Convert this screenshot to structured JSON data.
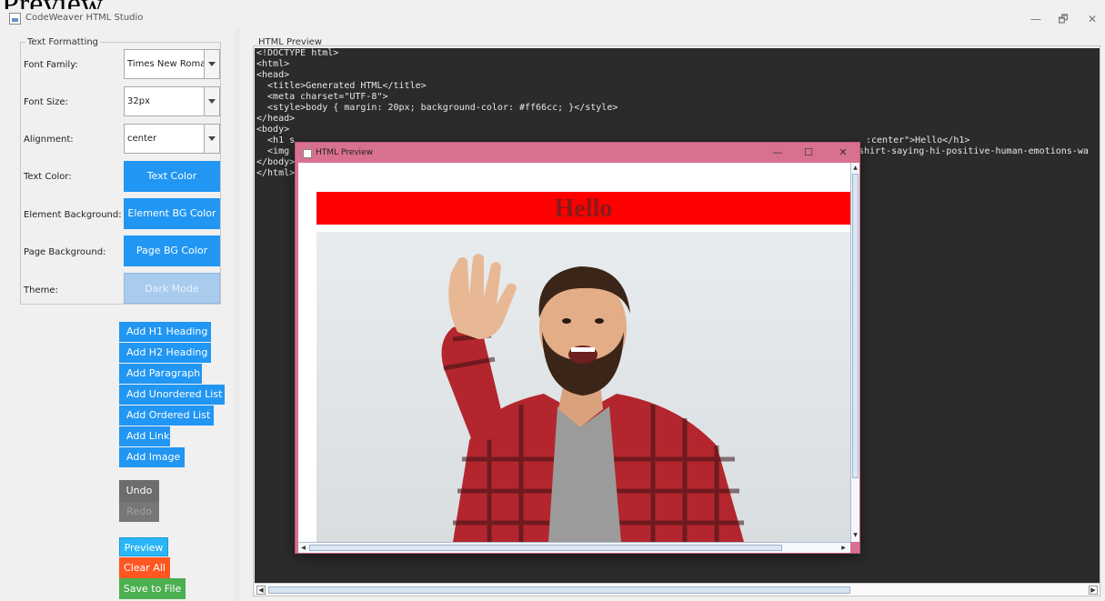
{
  "stray_heading": "Preview",
  "window": {
    "title": "CodeWeaver HTML Studio",
    "controls": {
      "minimize": "—",
      "maximize": "🗗",
      "close": "✕"
    }
  },
  "text_formatting": {
    "group_label": "Text Formatting",
    "font_family": {
      "label": "Font Family:",
      "value": "Times New Roman"
    },
    "font_size": {
      "label": "Font Size:",
      "value": "32px"
    },
    "alignment": {
      "label": "Alignment:",
      "value": "center"
    },
    "text_color": {
      "label": "Text Color:",
      "button": "Text Color"
    },
    "element_bg": {
      "label": "Element Background:",
      "button": "Element BG Color"
    },
    "page_bg": {
      "label": "Page Background:",
      "button": "Page BG Color"
    },
    "theme": {
      "label": "Theme:",
      "button": "Dark Mode"
    }
  },
  "element_buttons": {
    "h1": "Add H1 Heading",
    "h2": "Add H2 Heading",
    "paragraph": "Add Paragraph",
    "ul": "Add Unordered List",
    "ol": "Add Ordered List",
    "link": "Add Link",
    "image": "Add Image"
  },
  "history": {
    "undo": "Undo",
    "redo": "Redo"
  },
  "actions": {
    "preview": "Preview",
    "clear": "Clear All",
    "save": "Save to File"
  },
  "code_panel": {
    "label": "HTML Preview",
    "lines": [
      "<!DOCTYPE html>",
      "<html>",
      "<head>",
      "  <title>Generated HTML</title>",
      "  <meta charset=\"UTF-8\">",
      "  <style>body { margin: 20px; background-color: #ff66cc; }</style>",
      "</head>",
      "<body>",
      "  <h1 s",
      "  <img ",
      "</body>",
      "</html>"
    ],
    "hidden_tail_1": ":center\">Hello</h1>",
    "hidden_tail_2": "shirt-saying-hi-positive-human-emotions-wa"
  },
  "preview_window": {
    "title": "HTML Preview",
    "heading": "Hello",
    "image_alt": "Smiling bearded man in red plaid shirt waving hello",
    "controls": {
      "minimize": "—",
      "maximize": "☐",
      "close": "✕"
    }
  },
  "colors": {
    "primary_button": "#2196f3",
    "code_bg": "#2b2b2b",
    "popup_frame": "#d8708f",
    "heading_bg": "#ff0000",
    "heading_text": "#8b1a1a",
    "clear_button": "#ff5722",
    "save_button": "#4caf50",
    "preview_button": "#29b6f6"
  }
}
